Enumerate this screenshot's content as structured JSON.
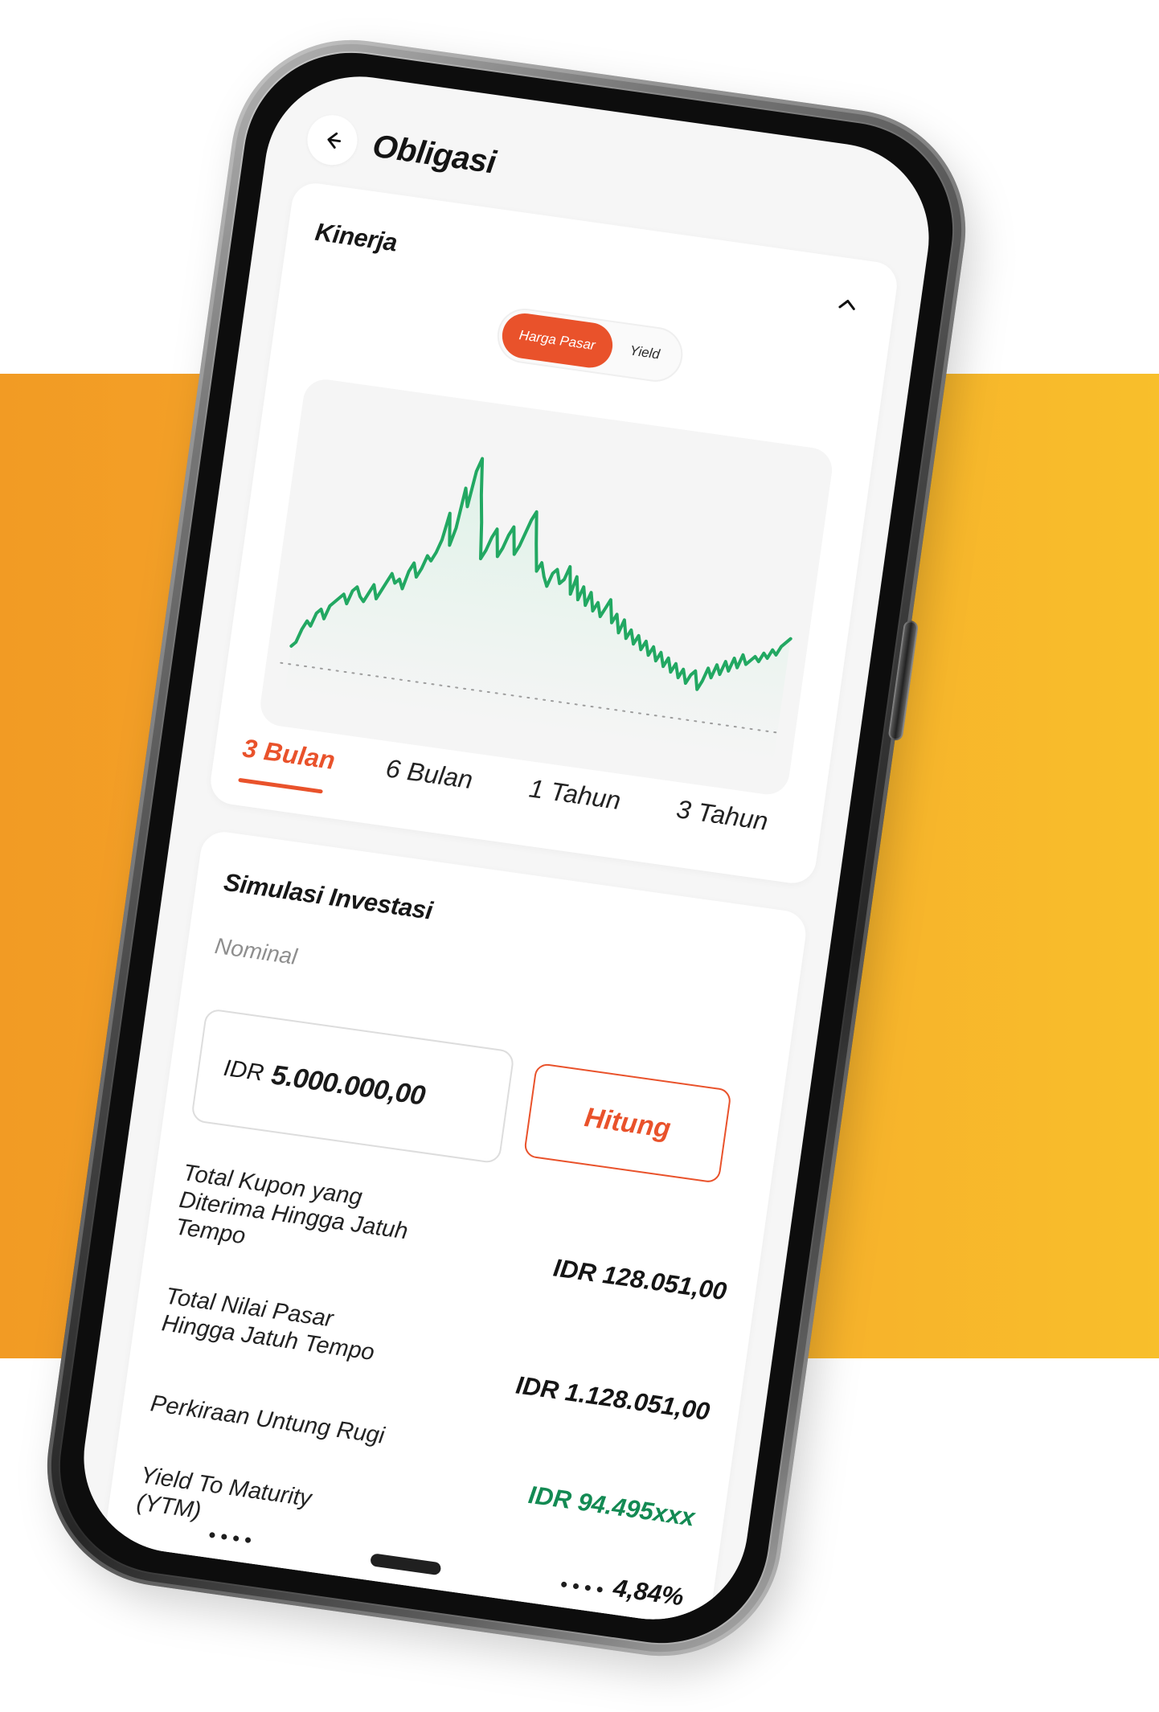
{
  "header": {
    "title": "Obligasi"
  },
  "kinerja": {
    "title": "Kinerja",
    "toggle": {
      "active": "Harga Pasar",
      "inactive": "Yield"
    },
    "tabs": [
      "3 Bulan",
      "6 Bulan",
      "1 Tahun",
      "3 Tahun"
    ],
    "active_tab": "3 Bulan"
  },
  "simulasi": {
    "title": "Simulasi Investasi",
    "nominal_label": "Nominal",
    "input": {
      "currency": "IDR",
      "value": "5.000.000,00"
    },
    "button_label": "Hitung",
    "results": [
      {
        "label": "Total Kupon yang Diterima Hingga Jatuh Tempo",
        "value": "IDR 128.051,00"
      },
      {
        "label": "Total Nilai Pasar Hingga Jatuh Tempo",
        "value": "IDR 1.128.051,00"
      },
      {
        "label": "Perkiraan Untung Rugi",
        "value": "IDR 94.495xxx"
      },
      {
        "label": "Yield To Maturity (YTM)",
        "value": "4,84%"
      }
    ]
  },
  "colors": {
    "accent": "#E9522B",
    "chart_line": "#22A862",
    "profit": "#138A53",
    "band_left": "#F29B24",
    "band_right": "#F8BF2B"
  },
  "icons": {
    "back": "arrow-left-icon",
    "collapse": "chevron-up-icon"
  },
  "chart_data": {
    "type": "area",
    "x": [
      0,
      1,
      2,
      3,
      4,
      5,
      6,
      7,
      8,
      9,
      10,
      11,
      12,
      13,
      14,
      15,
      16,
      17,
      18,
      19,
      20,
      21,
      22,
      23,
      24,
      25,
      26,
      27,
      28,
      29,
      30,
      31,
      32,
      33,
      34,
      35,
      36,
      37,
      38,
      39,
      40,
      41,
      42,
      43,
      44,
      45,
      46,
      47,
      48,
      49,
      50,
      51,
      52,
      53,
      54,
      55,
      56,
      57,
      58,
      59,
      60,
      61,
      62,
      63,
      64,
      65,
      66,
      67,
      68,
      69,
      70,
      71,
      72,
      73,
      74,
      75,
      76,
      77,
      78,
      79,
      80,
      81,
      82,
      83,
      84,
      85,
      86,
      87,
      88,
      89,
      90,
      91,
      92,
      93,
      94,
      95,
      96,
      97,
      98,
      99,
      100,
      101,
      102,
      103,
      104,
      105,
      106,
      107,
      108,
      109,
      110,
      111,
      112,
      113,
      114,
      115,
      116,
      117,
      118,
      119,
      120,
      121
    ],
    "series": [
      {
        "values": [
          36,
          37,
          40,
          42,
          41,
          44,
          45,
          43,
          46,
          47,
          48,
          49,
          47,
          50,
          51,
          49,
          48,
          50,
          52,
          49,
          51,
          53,
          55,
          53,
          54,
          52,
          56,
          58,
          55,
          57,
          60,
          59,
          61,
          64,
          70,
          63,
          67,
          76,
          72,
          80,
          83,
          75,
          69,
          61,
          63,
          66,
          68,
          62,
          64,
          67,
          69,
          63,
          65,
          68,
          71,
          73,
          66,
          60,
          62,
          59,
          57,
          60,
          61,
          58,
          59,
          62,
          56,
          60,
          55,
          58,
          54,
          57,
          53,
          55,
          52,
          54,
          56,
          51,
          53,
          49,
          52,
          48,
          50,
          47,
          49,
          46,
          48,
          45,
          47,
          44,
          46,
          43,
          45,
          42,
          44,
          41,
          43,
          40,
          42,
          43,
          39,
          41,
          44,
          42,
          45,
          43,
          46,
          44,
          47,
          45,
          48,
          46,
          47,
          48,
          47,
          49,
          48,
          50,
          49,
          51,
          52,
          53
        ],
        "color": "#22A862"
      }
    ],
    "grid": false
  }
}
